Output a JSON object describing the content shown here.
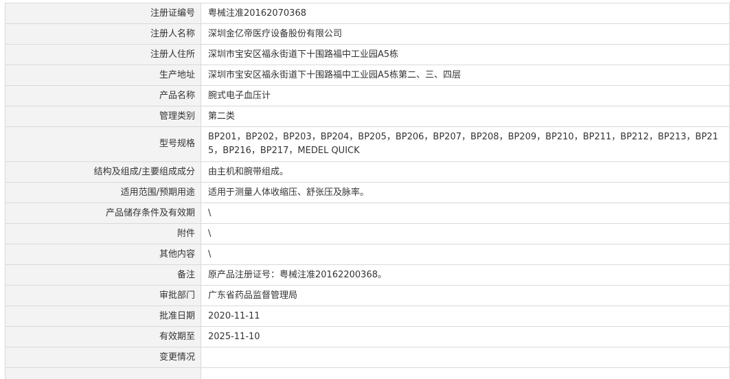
{
  "rows": [
    {
      "label": "注册证编号",
      "value": "粤械注准20162070368"
    },
    {
      "label": "注册人名称",
      "value": "深圳金亿帝医疗设备股份有限公司"
    },
    {
      "label": "注册人住所",
      "value": "深圳市宝安区福永街道下十围路福中工业园A5栋"
    },
    {
      "label": "生产地址",
      "value": "深圳市宝安区福永街道下十围路福中工业园A5栋第二、三、四层"
    },
    {
      "label": "产品名称",
      "value": "腕式电子血压计"
    },
    {
      "label": "管理类别",
      "value": "第二类"
    },
    {
      "label": "型号规格",
      "value": "BP201，BP202，BP203，BP204，BP205，BP206，BP207，BP208，BP209，BP210，BP211，BP212，BP213，BP215，BP216，BP217，MEDEL QUICK"
    },
    {
      "label": "结构及组成/主要组成成分",
      "value": "由主机和腕带组成。"
    },
    {
      "label": "适用范围/预期用途",
      "value": "适用于测量人体收缩压、舒张压及脉率。"
    },
    {
      "label": "产品储存条件及有效期",
      "value": "\\"
    },
    {
      "label": "附件",
      "value": "\\"
    },
    {
      "label": "其他内容",
      "value": "\\"
    },
    {
      "label": "备注",
      "value": "原产品注册证号：粤械注准20162200368。"
    },
    {
      "label": "审批部门",
      "value": "广东省药品监督管理局"
    },
    {
      "label": "批准日期",
      "value": "2020-11-11"
    },
    {
      "label": "有效期至",
      "value": "2025-11-10"
    },
    {
      "label": "变更情况",
      "value": ""
    },
    {
      "label": "",
      "value": ""
    }
  ]
}
